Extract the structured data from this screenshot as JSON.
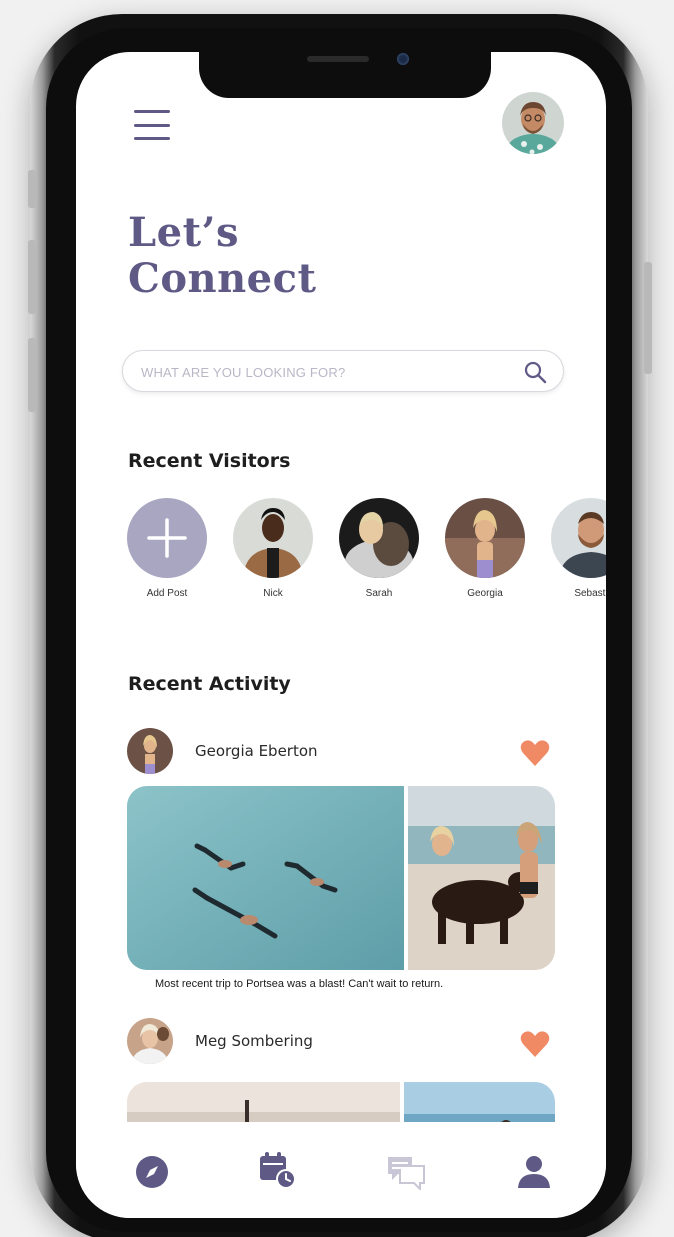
{
  "header": {
    "menu_icon": "hamburger-icon",
    "profile_icon": "profile-avatar"
  },
  "headline": {
    "line1": "Let’s",
    "line2": "Connect"
  },
  "search": {
    "placeholder": "WHAT ARE YOU LOOKING FOR?",
    "icon": "search-icon"
  },
  "recent_visitors": {
    "title": "Recent Visitors",
    "items": [
      {
        "label": "Add Post",
        "icon": "plus-icon"
      },
      {
        "label": "Nick"
      },
      {
        "label": "Sarah"
      },
      {
        "label": "Georgia"
      },
      {
        "label": "Sebasti"
      }
    ]
  },
  "recent_activity": {
    "title": "Recent Activity",
    "posts": [
      {
        "author": "Georgia Eberton",
        "caption": "Most recent trip to Portsea was a blast! Can't wait to return.",
        "liked": true
      },
      {
        "author": "Meg Sombering",
        "caption": "",
        "liked": true
      }
    ]
  },
  "bottom_nav": [
    {
      "name": "compass-icon",
      "active": false
    },
    {
      "name": "calendar-clock-icon",
      "active": false
    },
    {
      "name": "chat-icon",
      "active": false
    },
    {
      "name": "profile-icon",
      "active": true
    }
  ],
  "colors": {
    "accent": "#5e5a85",
    "add_circle": "#a8a6c0",
    "heart": "#f08a64",
    "chat_inactive": "#c9c7d6"
  }
}
